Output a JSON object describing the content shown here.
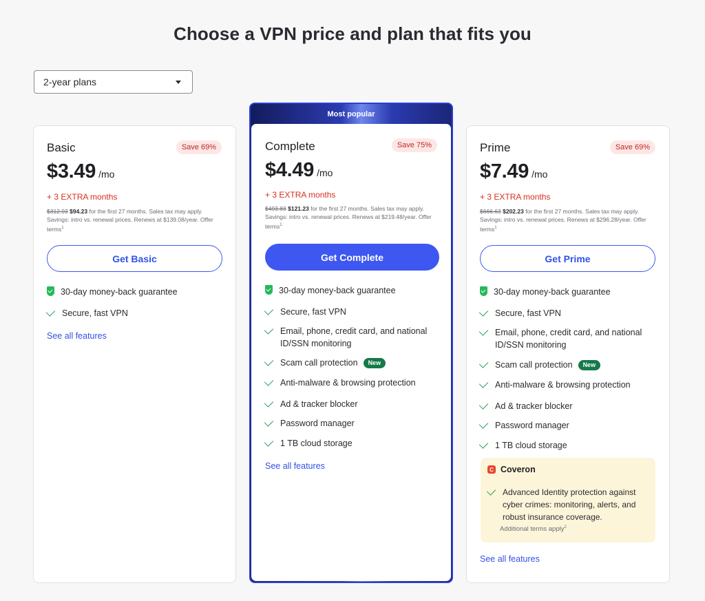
{
  "title": "Choose a VPN price and plan that fits you",
  "plan_select": {
    "value": "2-year plans"
  },
  "featured_banner": "Most popular",
  "plans": {
    "basic": {
      "name": "Basic",
      "save": "Save 69%",
      "price": "$3.49",
      "per": "/mo",
      "extra": "+ 3 EXTRA months",
      "old_price": "$312.93",
      "new_price": "$94.23",
      "fine_print": "for the first 27 months. Sales tax may apply. Savings: intro vs. renewal prices. Renews at $139.08/year. Offer terms",
      "fine_sup": "1",
      "cta": "Get Basic",
      "features": [
        "30-day money-back guarantee",
        "Secure, fast VPN"
      ],
      "see_all": "See all features"
    },
    "complete": {
      "name": "Complete",
      "save": "Save 75%",
      "price": "$4.49",
      "per": "/mo",
      "extra": "+ 3 EXTRA months",
      "old_price": "$493.83",
      "new_price": "$121.23",
      "fine_print": "for the first 27 months. Sales tax may apply. Savings: intro vs. renewal prices. Renews at $219.48/year. Offer terms",
      "fine_sup": "1",
      "cta": "Get Complete",
      "features": [
        "30-day money-back guarantee",
        "Secure, fast VPN",
        "Email, phone, credit card, and national ID/SSN monitoring",
        "Scam call protection",
        "Anti-malware & browsing protection",
        "Ad & tracker blocker",
        "Password manager",
        "1 TB cloud storage"
      ],
      "new_label": "New",
      "see_all": "See all features"
    },
    "prime": {
      "name": "Prime",
      "save": "Save 69%",
      "price": "$7.49",
      "per": "/mo",
      "extra": "+ 3 EXTRA months",
      "old_price": "$666.63",
      "new_price": "$202.23",
      "fine_print": "for the first 27 months. Sales tax may apply. Savings: intro vs. renewal prices. Renews at $296.28/year. Offer terms",
      "fine_sup": "1",
      "cta": "Get Prime",
      "features": [
        "30-day money-back guarantee",
        "Secure, fast VPN",
        "Email, phone, credit card, and national ID/SSN monitoring",
        "Scam call protection",
        "Anti-malware & browsing protection",
        "Ad & tracker blocker",
        "Password manager",
        "1 TB cloud storage"
      ],
      "new_label": "New",
      "coveron": {
        "logo": "C",
        "title": "Coveron",
        "feature": "Advanced Identity protection against cyber crimes: monitoring, alerts, and robust insurance coverage.",
        "terms": "Additional terms apply",
        "terms_sup": "2"
      },
      "see_all": "See all features"
    }
  }
}
